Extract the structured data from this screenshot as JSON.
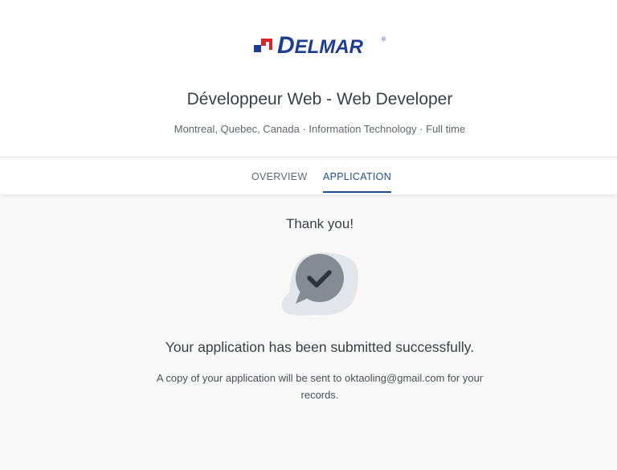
{
  "brand": {
    "name_first": "D",
    "name_rest": "ELMAR",
    "registered": "®",
    "colors": {
      "primary": "#1e3d8f",
      "accent_red": "#d9252a"
    }
  },
  "job": {
    "title": "Développeur Web - Web Developer",
    "meta": "Montreal, Quebec, Canada · Information Technology · Full time"
  },
  "tabs": [
    {
      "label": "OVERVIEW",
      "active": false
    },
    {
      "label": "APPLICATION",
      "active": true
    }
  ],
  "confirmation": {
    "heading": "Thank you!",
    "icon": "chat-bubble-check-icon",
    "message": "Your application has been submitted successfully.",
    "note": "A copy of your application will be sent to oktaoling@gmail.com for your records."
  },
  "colors": {
    "tab_active": "#1f4e8c",
    "page_background": "#f8f8f8"
  }
}
